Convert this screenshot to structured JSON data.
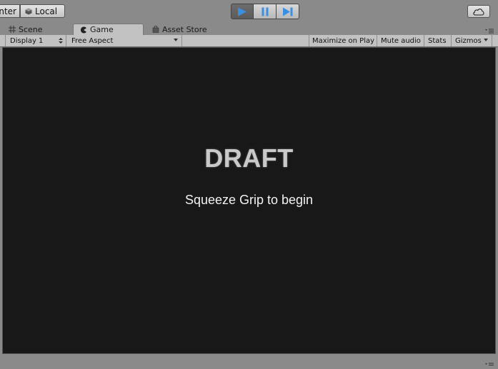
{
  "toolbar": {
    "pivot_mode_label": "nter",
    "pivot_rotation_label": "Local",
    "play_icon": "play-icon",
    "pause_icon": "pause-icon",
    "step_icon": "step-icon",
    "cloud_icon": "cloud-icon",
    "accent_color": "#3b8fe0"
  },
  "tabs": [
    {
      "label": "Scene",
      "icon": "grid-icon"
    },
    {
      "label": "Game",
      "icon": "pacman-icon",
      "active": true
    },
    {
      "label": "Asset Store",
      "icon": "bag-icon"
    }
  ],
  "viewbar": {
    "display": "Display 1",
    "aspect": "Free Aspect",
    "maximize": "Maximize on Play",
    "mute": "Mute audio",
    "stats": "Stats",
    "gizmos": "Gizmos"
  },
  "game": {
    "title": "DRAFT",
    "prompt": "Squeeze Grip to begin",
    "background": "#181818"
  }
}
